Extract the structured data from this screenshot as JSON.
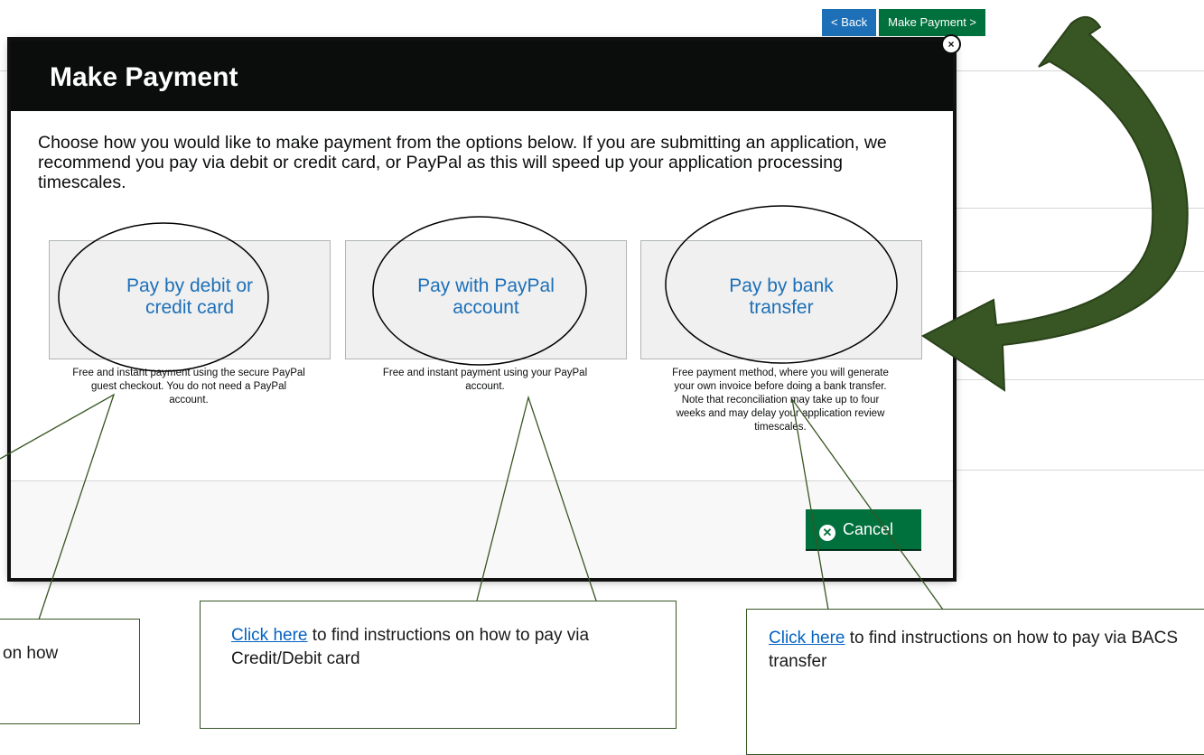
{
  "nav": {
    "back_label": "< Back",
    "make_payment_label": "Make Payment >"
  },
  "modal": {
    "title": "Make Payment",
    "close_glyph": "×",
    "intro": "Choose how you would like to make payment from the options below. If you are submitting an application, we recommend you pay via debit or credit card, or PayPal as this will speed up your application processing timescales.",
    "options": [
      {
        "label": "Pay by debit or credit card",
        "description": "Free and instant payment using the secure PayPal guest checkout. You do not need a PayPal account."
      },
      {
        "label": "Pay with PayPal account",
        "description": "Free and instant payment using your PayPal account."
      },
      {
        "label": "Pay by bank transfer",
        "description": "Free payment method, where you will generate your own invoice before doing a bank transfer. Note that reconciliation may take up to four weeks and may delay your application review timescales."
      }
    ],
    "cancel_label": "Cancel",
    "cancel_icon": "x-circle-icon"
  },
  "callouts": [
    {
      "text": "on how"
    },
    {
      "link": "Click here",
      "text": " to find instructions on how to pay via Credit/Debit card"
    },
    {
      "link": "Click here",
      "text": " to find instructions on how to pay via BACS transfer"
    }
  ],
  "colors": {
    "accent_green": "#00703c",
    "link_blue": "#1d70b8",
    "arrow_green": "#375623",
    "header_black": "#0b0c0c"
  }
}
